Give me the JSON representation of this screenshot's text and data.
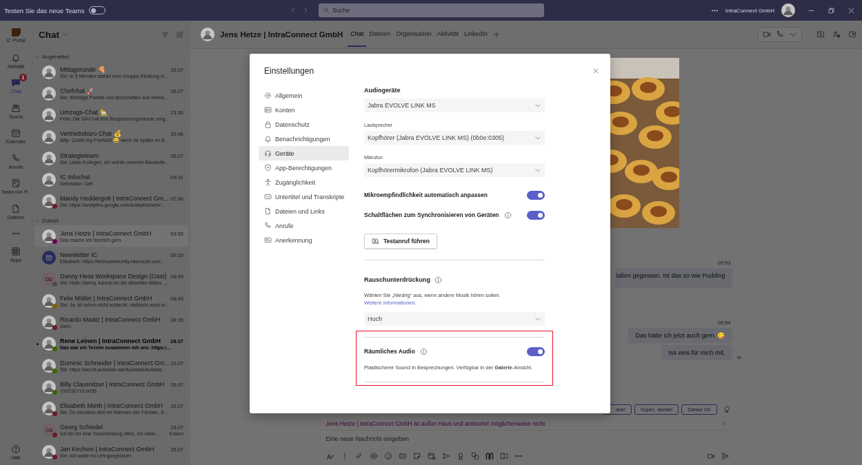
{
  "top_bar": {
    "try_new": {
      "label": "Testen Sie das neue Teams",
      "on": false
    },
    "search": {
      "placeholder": "Suche"
    },
    "org": "IntraConnect GmbH"
  },
  "rail": [
    {
      "label": "IC Portal",
      "selected": false
    },
    {
      "label": "Aktivität",
      "selected": false
    },
    {
      "label": "Chat",
      "selected": true,
      "badge": "1"
    },
    {
      "label": "Teams",
      "selected": false
    },
    {
      "label": "Kalender",
      "selected": false
    },
    {
      "label": "Anrufe",
      "selected": false
    },
    {
      "label": "Tasks von P...",
      "selected": false
    },
    {
      "label": "Dateien",
      "selected": false
    },
    {
      "label": "Apps",
      "selected": false
    }
  ],
  "rail_bottom": {
    "label": "Hilfe"
  },
  "chat_list": {
    "title": "Chat",
    "sections": [
      {
        "title": "Angeheftet",
        "expanded": true,
        "chats": [
          {
            "name": "Mittagsrunde 🍕",
            "time": "26.07",
            "preview": "Sie: In 5 Minuten startet eine Gruppe Richtung H...",
            "unread": false,
            "selected": false
          },
          {
            "name": "Chefchat 🚀",
            "time": "06.07",
            "preview": "Sie: Wichtige Punkte und Botschaften aus meine...",
            "unread": false,
            "selected": false
          },
          {
            "name": "Umzugs-Chat 🏡",
            "time": "23.06",
            "preview": "Felix: Die SÄV hat ihre Besprechungsräume umg...",
            "unread": false,
            "selected": false
          },
          {
            "name": "Vertriebsbüro Chat 💰",
            "time": "30.06",
            "preview": "Billy: GuM0 my FrIeNdS 😄 wenn ihr später im B...",
            "unread": false,
            "selected": false
          },
          {
            "name": "Strategieteam",
            "time": "06.07",
            "preview": "Sie: Liebe Kollegen, ich würde unseren Baustelle...",
            "unread": false,
            "selected": false
          },
          {
            "name": "IC Infochat",
            "time": "09:31",
            "preview": "Sebastian: Geil",
            "unread": false,
            "selected": false
          },
          {
            "name": "Mandy Heddergott | IntraConnect Gm...",
            "time": "02.06",
            "preview": "Sie: https://analytics.google.com/analytics/web/...",
            "color": "#6c1b29",
            "unread": false,
            "selected": false
          }
        ]
      },
      {
        "title": "Zuletzt",
        "expanded": true,
        "chats": [
          {
            "name": "Jens Hetze | IntraConnect GmbH",
            "time": "09:55",
            "preview": "Das mache ich herzlich gern.",
            "color": "#630057",
            "unread": false,
            "selected": true
          },
          {
            "name": "Newsletter IC",
            "time": "09:16",
            "preview": "Elisabeth: https://techcommunity.microsoft.com...",
            "kind": "app",
            "unread": false,
            "selected": false
          },
          {
            "name": "Danny Hess Workspace Design (Gast)",
            "time": "08:49",
            "preview": "Sie: Hallo Danny, kannst du die aktuellen Bilder, ...",
            "kind": "initials",
            "initials": "DD",
            "color": "#4c4b4a",
            "unread": false,
            "selected": false
          },
          {
            "name": "Felix Müller | IntraConnect GmbH",
            "time": "08:43",
            "preview": "Sie: Ja, ist schon nicht schlecht, vielleicht auch in...",
            "color": "#816000",
            "unread": false,
            "selected": false
          },
          {
            "name": "Ricardo Maatz | IntraConnect GmbH",
            "time": "08:35",
            "preview": "Gern.",
            "color": "#6c1b29",
            "unread": false,
            "selected": false
          },
          {
            "name": "Rene Leinen | IntraConnect GmbH",
            "time": "26.07",
            "preview": "Das war ein Termin zusammen mit uns :https:/...",
            "color": "#3b6500",
            "unread": true,
            "selected": false
          },
          {
            "name": "Dominic Schneider | IntraConnect Gm...",
            "time": "26.07",
            "preview": "Sie: https://ww18.autotask.net/Autotask/Autotas...",
            "color": "#3b6500",
            "unread": false,
            "selected": false
          },
          {
            "name": "Billy Clausnitzer | IntraConnect GmbH",
            "time": "26.07",
            "preview": "T20230710.0035",
            "color": "#3b6500",
            "unread": false,
            "selected": false
          },
          {
            "name": "Elisabeth Mieth | IntraConnect GmbH",
            "time": "26.07",
            "preview": "Sie: Du könntest dich im Rahmen der Formen, S...",
            "color": "#6c1b29",
            "unread": false,
            "selected": false
          },
          {
            "name": "Georg Schiedel",
            "time": "25.07",
            "preview": "Ich bin für eine Verschiebung offen, ich meld...",
            "kind": "initials",
            "initials": "GS",
            "color": "#6c1b29",
            "tag": "Extern",
            "unread": false,
            "selected": false
          },
          {
            "name": "Jan Kircheis | IntraConnect GmbH",
            "time": "25.07",
            "preview": "Sie: Ich warte im Lehrgangsraum",
            "color": "#6c1b29",
            "unread": false,
            "selected": false
          }
        ]
      }
    ]
  },
  "conversation": {
    "title": "Jens Hetze | IntraConnect GmbH",
    "tabs": [
      {
        "label": "Chat",
        "selected": true
      },
      {
        "label": "Dateien",
        "selected": false
      },
      {
        "label": "Organisation",
        "selected": false
      },
      {
        "label": "Aktivität",
        "selected": false
      },
      {
        "label": "LinkedIn",
        "selected": false
      }
    ],
    "messages": [
      {
        "kind": "picture"
      },
      {
        "kind": "time",
        "text": "09:53"
      },
      {
        "kind": "bubble",
        "text": "talien gegessen. Ist das so wie Pudding",
        "seen": false
      },
      {
        "kind": "time",
        "text": "09:54"
      },
      {
        "kind": "bubble",
        "text": "Das hätte ich jetzt auch gern. 😋",
        "seen": false
      },
      {
        "kind": "bubble",
        "text": "Iss eins für mich mit.",
        "seen": true
      }
    ],
    "suggestions": [
      "ank!",
      "Super, danke!",
      "Danke Dir"
    ],
    "away_notice": "Jens Hetze | IntraConnect GmbH ist außer Haus und antwortet möglicherweise nicht",
    "compose": {
      "placeholder": "Eine neue Nachricht eingeben"
    }
  },
  "settings_dialog": {
    "title": "Einstellungen",
    "nav": [
      {
        "label": "Allgemein",
        "selected": false
      },
      {
        "label": "Konten",
        "selected": false
      },
      {
        "label": "Datenschutz",
        "selected": false
      },
      {
        "label": "Benachrichtigungen",
        "selected": false
      },
      {
        "label": "Geräte",
        "selected": true
      },
      {
        "label": "App-Berechtigungen",
        "selected": false
      },
      {
        "label": "Zugänglichkeit",
        "selected": false
      },
      {
        "label": "Untertitel und Transkripte",
        "selected": false
      },
      {
        "label": "Dateien und Links",
        "selected": false
      },
      {
        "label": "Anrufe",
        "selected": false
      },
      {
        "label": "Anerkennung",
        "selected": false
      }
    ],
    "groups": [
      {
        "highlighted": false,
        "rows": [
          {
            "kind": "heading",
            "text": "Audiogeräte",
            "info": false
          },
          {
            "kind": "dropdown",
            "value": "Jabra EVOLVE LINK MS"
          },
          {
            "kind": "label",
            "text": "Lautsprecher"
          },
          {
            "kind": "dropdown",
            "value": "Kopfhörer (Jabra EVOLVE LINK MS) (0b0e:0305)"
          },
          {
            "kind": "label",
            "text": "Mikrofon"
          },
          {
            "kind": "dropdown",
            "value": "Kopfhörermikrofon (Jabra EVOLVE LINK MS)"
          },
          {
            "kind": "toggle",
            "text": "Mikroempfindlichkeit automatisch anpassen",
            "info": false,
            "on": true
          },
          {
            "kind": "toggle",
            "text": "Schaltflächen zum Synchronisieren von Geräten",
            "info": true,
            "on": true
          },
          {
            "kind": "button",
            "text": "Testanruf führen"
          },
          {
            "kind": "divider"
          },
          {
            "kind": "heading",
            "text": "Rauschunterdrückung",
            "info": true
          },
          {
            "kind": "note",
            "text": "Wählen Sie „Niedrig“ aus, wenn andere Musik hören sollen.",
            "link": "Weitere Informationen."
          },
          {
            "kind": "dropdown",
            "value": "Hoch"
          }
        ]
      },
      {
        "highlighted": true,
        "rows": [
          {
            "kind": "divider"
          },
          {
            "kind": "toggle",
            "text": "Räumliches Audio",
            "info": true,
            "on": true
          },
          {
            "kind": "note",
            "text": "Plastischerer Sound in Besprechungen. Verfügbar in der **Galerie**-Ansicht."
          },
          {
            "kind": "divider"
          }
        ]
      }
    ]
  }
}
